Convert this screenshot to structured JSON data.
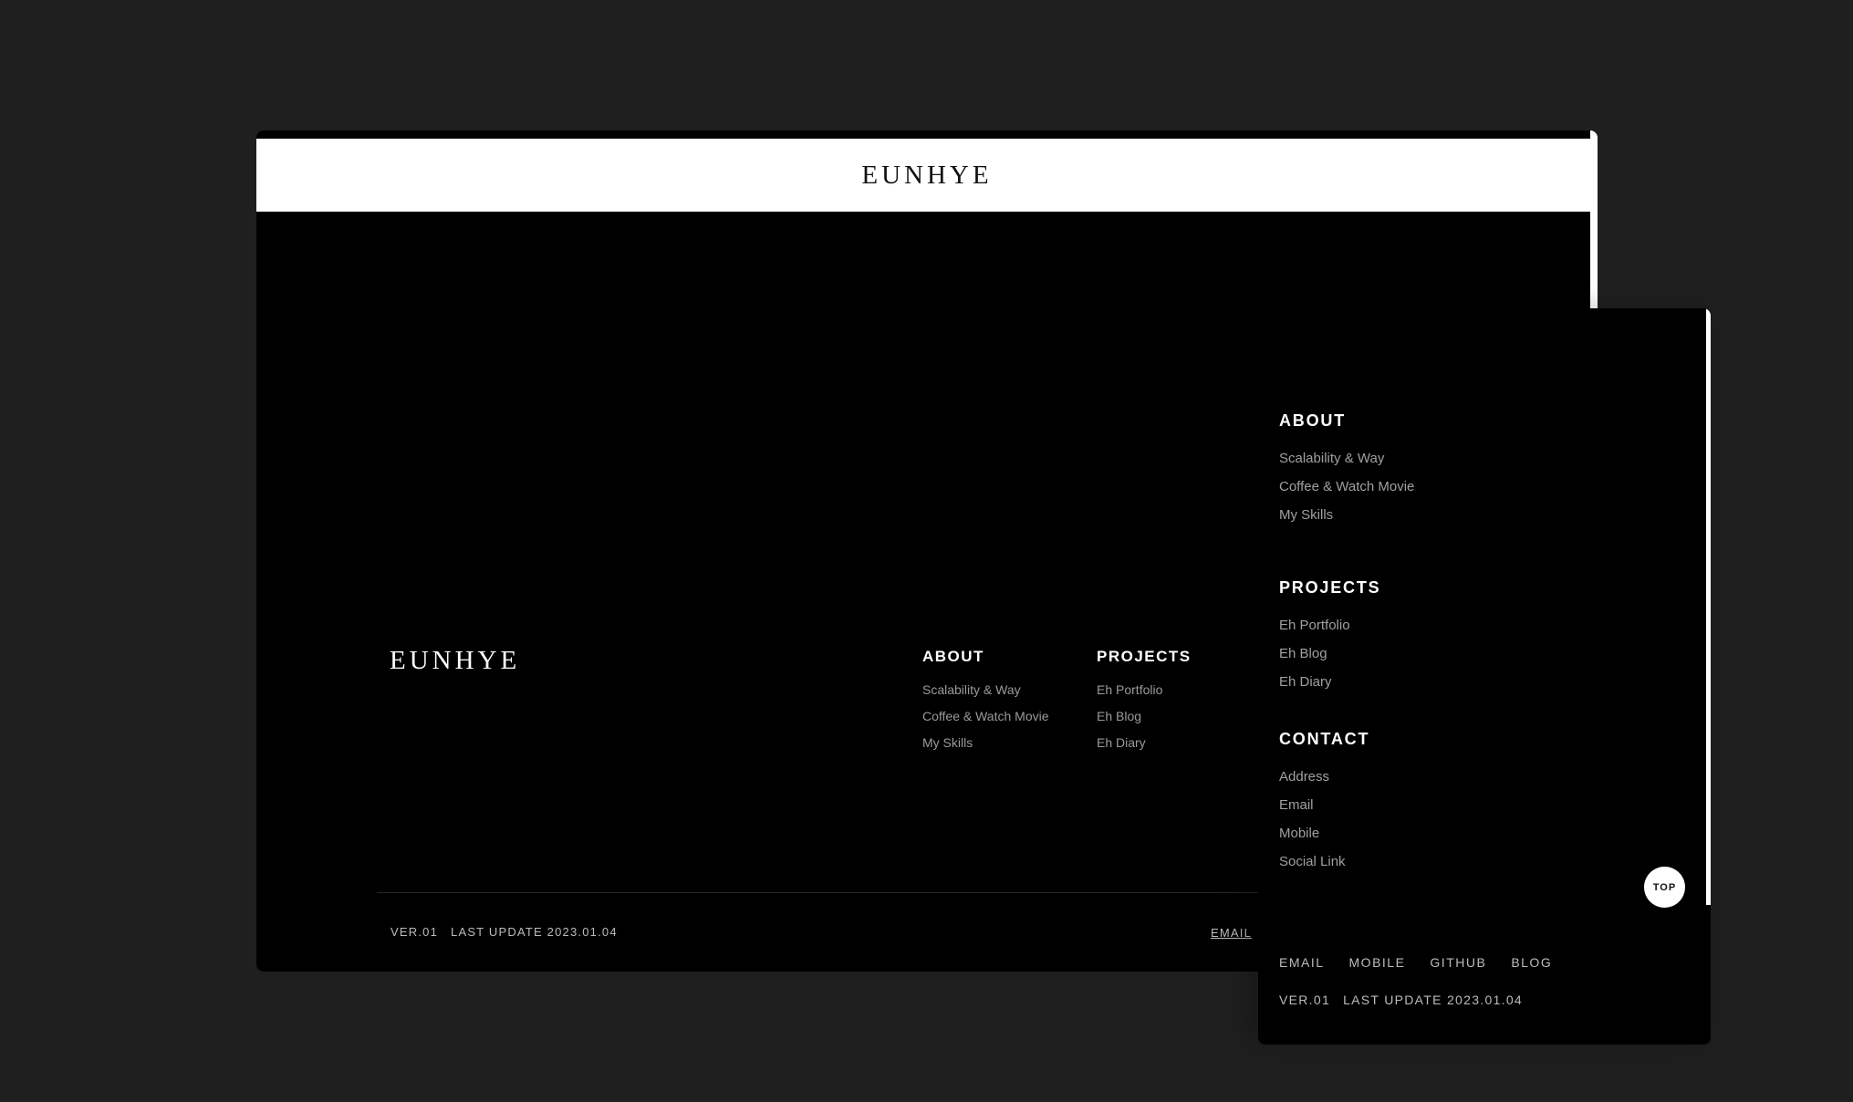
{
  "brand": {
    "logo_text": "EUNHYE"
  },
  "footer_nav": {
    "about": {
      "heading": "ABOUT",
      "items": [
        "Scalability & Way",
        "Coffee & Watch Movie",
        "My Skills"
      ]
    },
    "projects": {
      "heading": "PROJECTS",
      "items": [
        "Eh Portfolio",
        "Eh Blog",
        "Eh Diary"
      ]
    },
    "contact": {
      "heading": "CONTACT",
      "items": [
        "Address",
        "Email",
        "Mobile",
        "Social Link"
      ]
    }
  },
  "footer_bottom": {
    "version": "VER.01",
    "last_update": "LAST UPDATE 2023.01.04",
    "links": [
      "EMAIL",
      "MOBILE",
      "GITHUB",
      "BLOG"
    ]
  },
  "top_button": {
    "label": "TOP"
  },
  "colors": {
    "page_bg": "#1f1f1f",
    "panel_bg": "#000000",
    "header_bg": "#ffffff",
    "link_muted": "#9a9a9a"
  }
}
